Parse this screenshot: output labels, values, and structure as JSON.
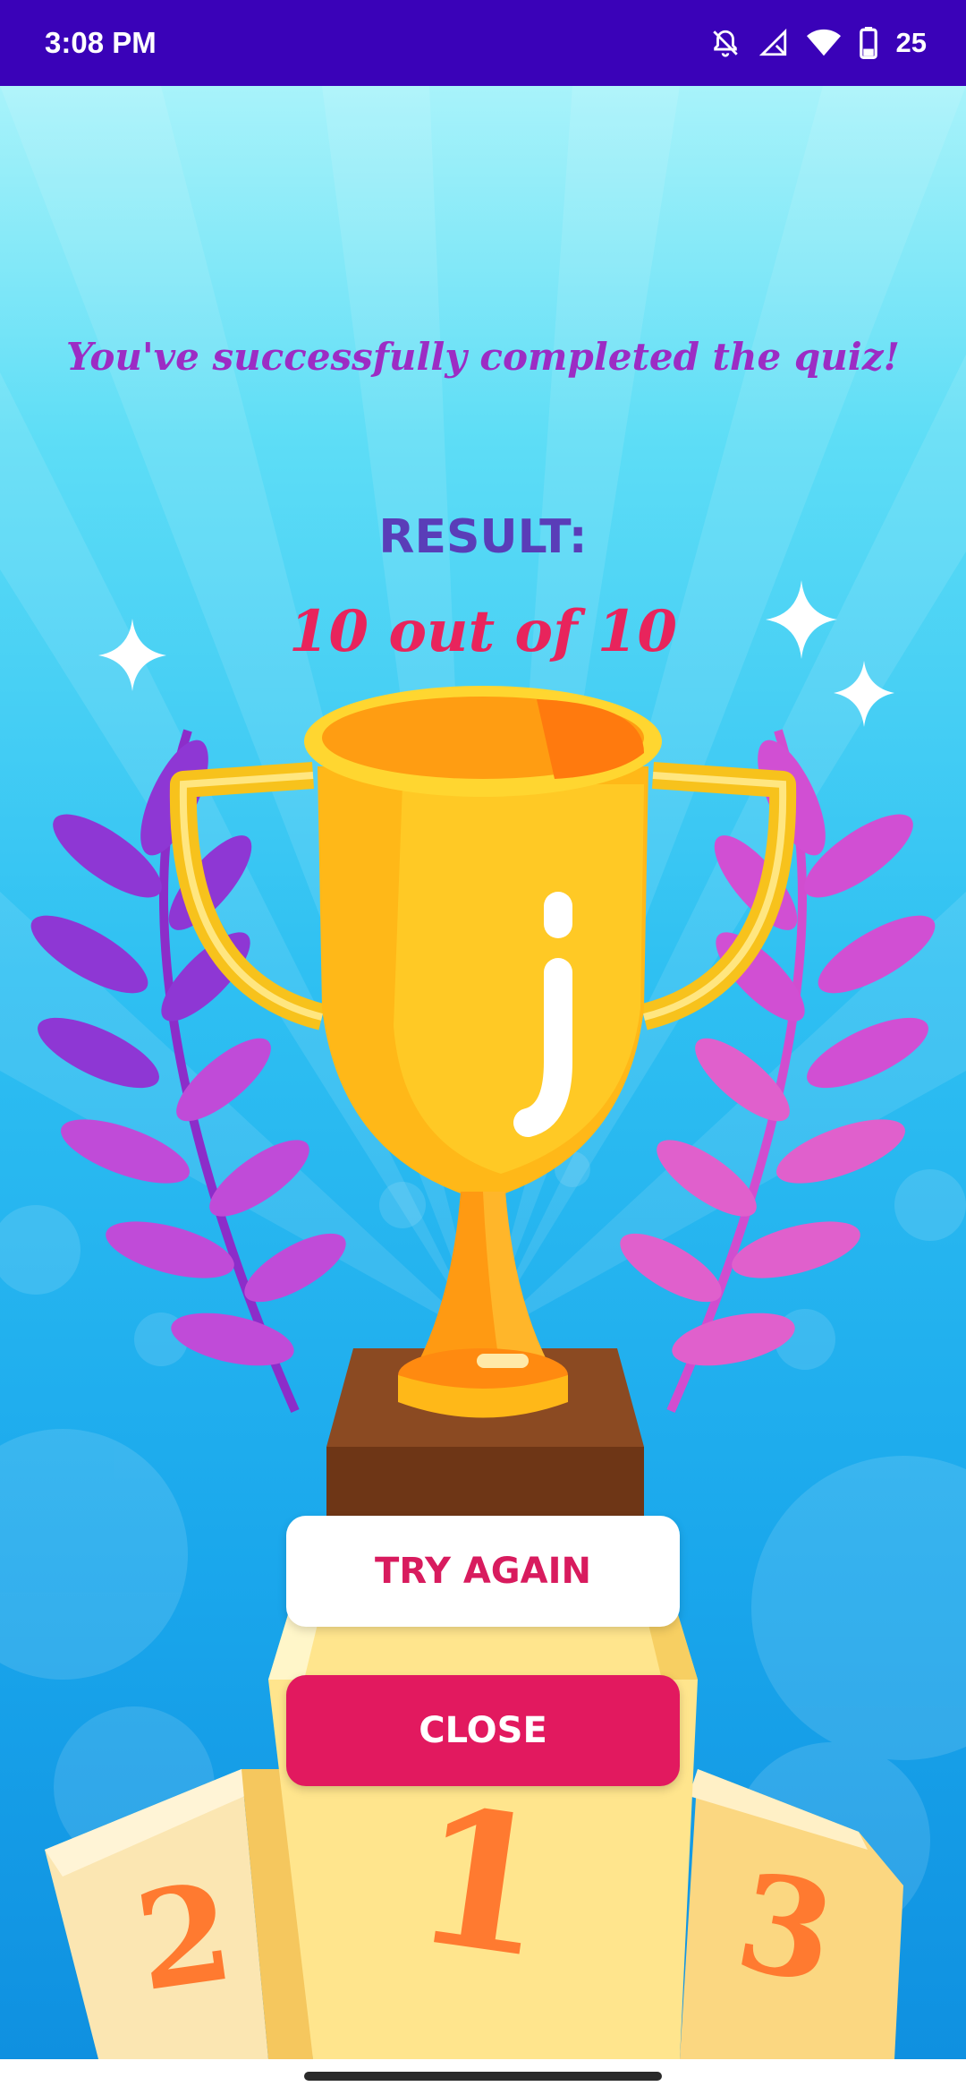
{
  "status_bar": {
    "time": "3:08 PM",
    "battery_level": "25",
    "icons": [
      "bell-off-icon",
      "signal-icon",
      "wifi-icon",
      "battery-icon"
    ]
  },
  "quiz_result": {
    "message": "You've successfully completed the quiz!",
    "label": "RESULT:",
    "score": "10 out of 10"
  },
  "buttons": {
    "try_again": "TRY AGAIN",
    "close": "CLOSE"
  },
  "podium": {
    "first": "1",
    "second": "2",
    "third": "3"
  },
  "colors": {
    "status_bar": "#3A02B8",
    "message": "#9C2CC4",
    "label": "#5A3DB8",
    "score": "#E8245C",
    "close_button": "#E2195F",
    "trophy": "#FFC21A"
  }
}
